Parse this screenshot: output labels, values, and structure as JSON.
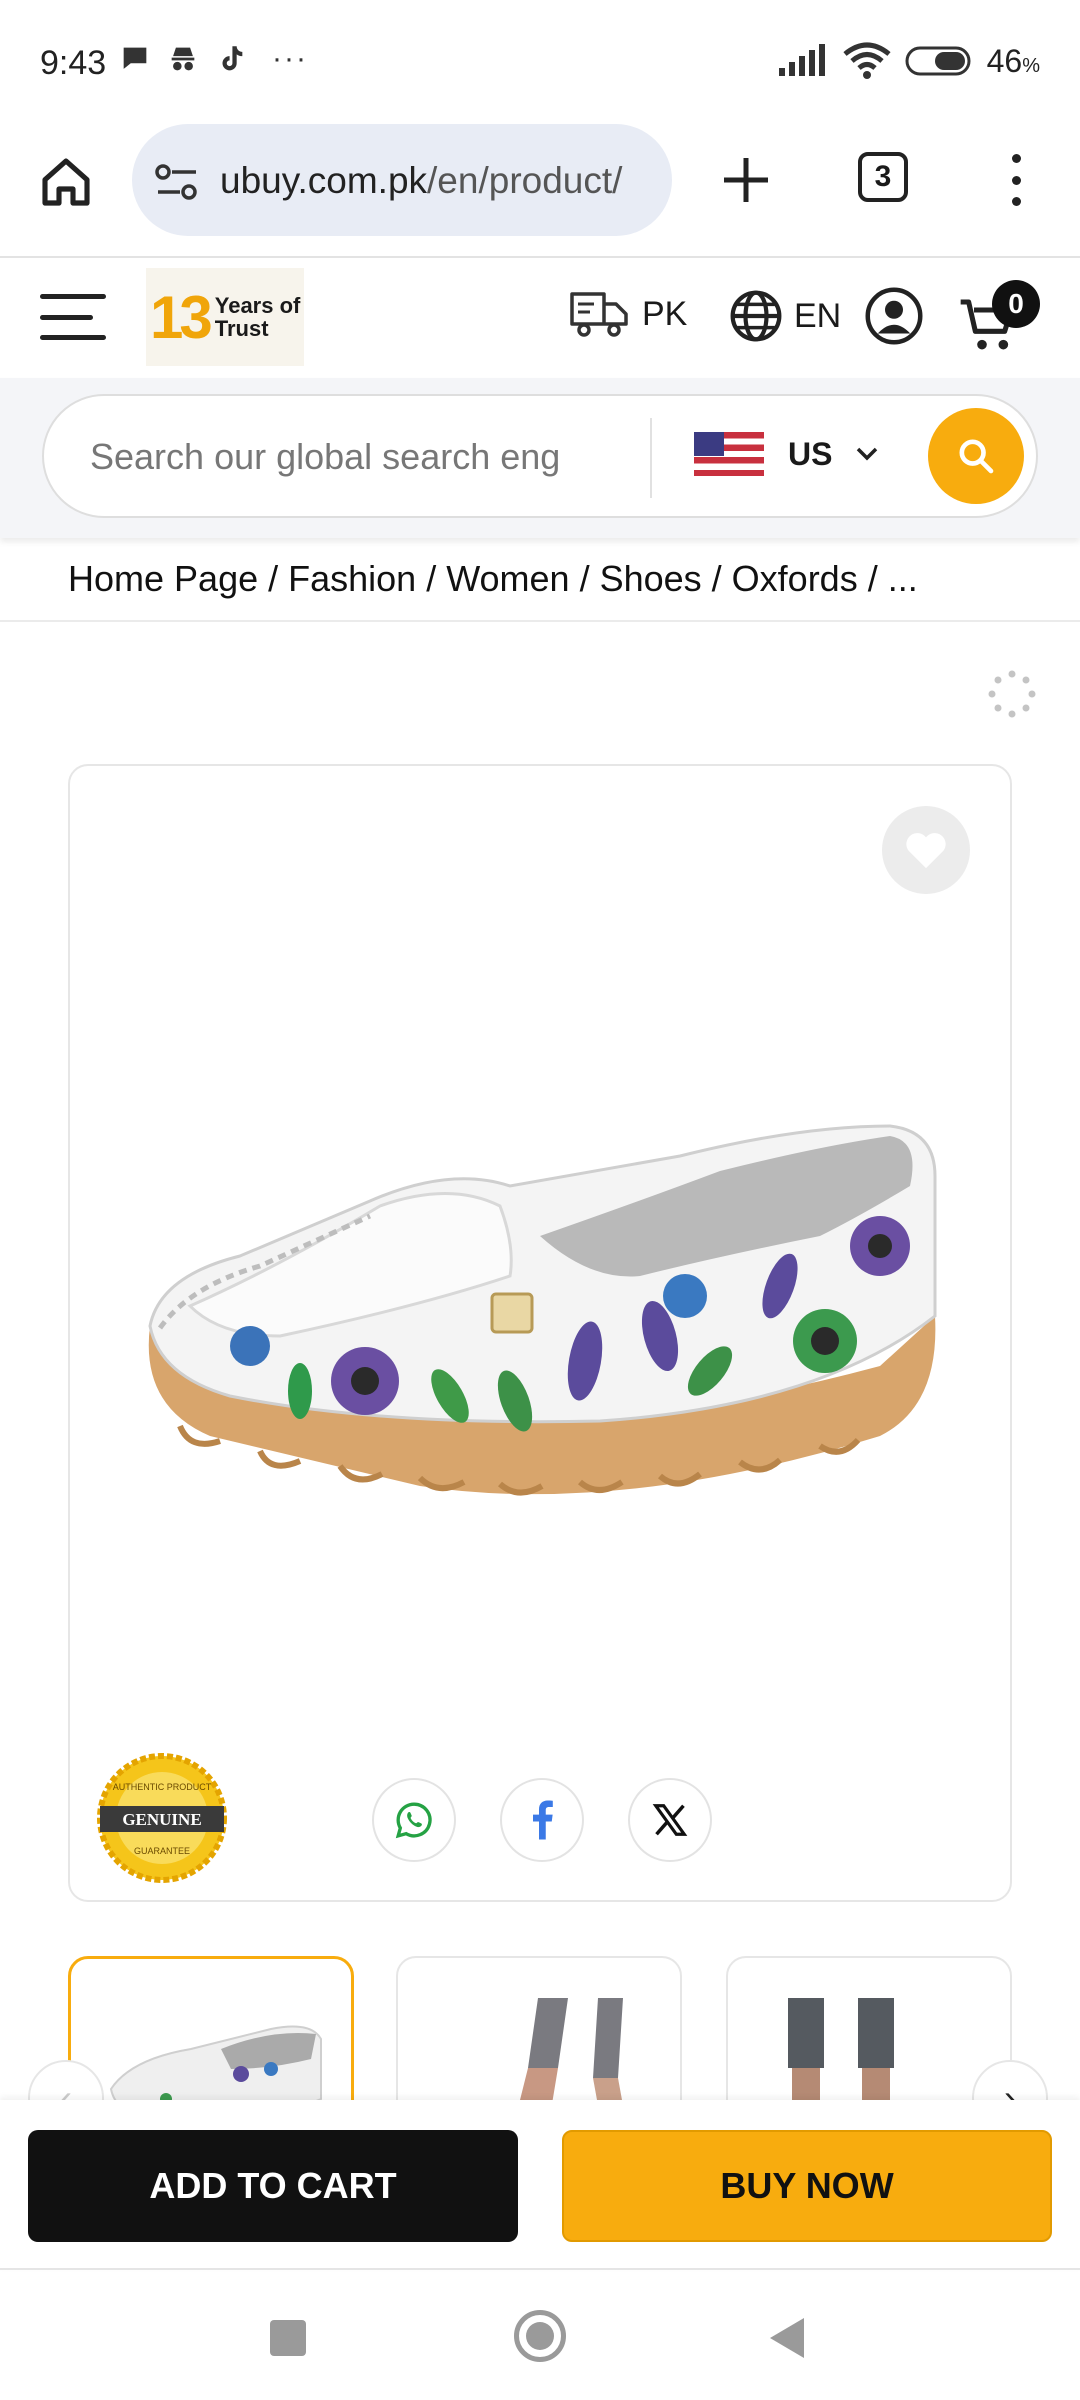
{
  "status_bar": {
    "time": "9:43",
    "notification_icons": [
      "chat-bubble-icon",
      "incognito-icon",
      "tiktok-icon",
      "more-dots-icon"
    ],
    "more": "···",
    "battery": "46",
    "battery_unit": "%"
  },
  "browser": {
    "url_domain": "ubuy.com.pk",
    "url_path": "/en/product/",
    "tab_count": "3"
  },
  "header": {
    "logo_number": "13",
    "logo_line1": "Years of",
    "logo_line2": "Trust",
    "ship_country": "PK",
    "language": "EN",
    "cart_count": "0"
  },
  "search": {
    "placeholder": "Search our global search eng",
    "store_country": "US"
  },
  "breadcrumb": "Home Page / Fashion / Women / Shoes / Oxfords / ...",
  "product": {
    "badge_text": "GENUINE",
    "badge_top": "AUTHENTIC PRODUCT",
    "badge_bottom": "GUARANTEE",
    "share": [
      "whatsapp-icon",
      "facebook-icon",
      "x-icon"
    ]
  },
  "thumbnails": {
    "prev": "‹",
    "next": "›"
  },
  "actions": {
    "add_to_cart": "ADD TO CART",
    "buy_now": "BUY NOW"
  },
  "colors": {
    "accent": "#f8ac0e",
    "dark": "#111111",
    "url_pill": "#e8ecf5"
  }
}
